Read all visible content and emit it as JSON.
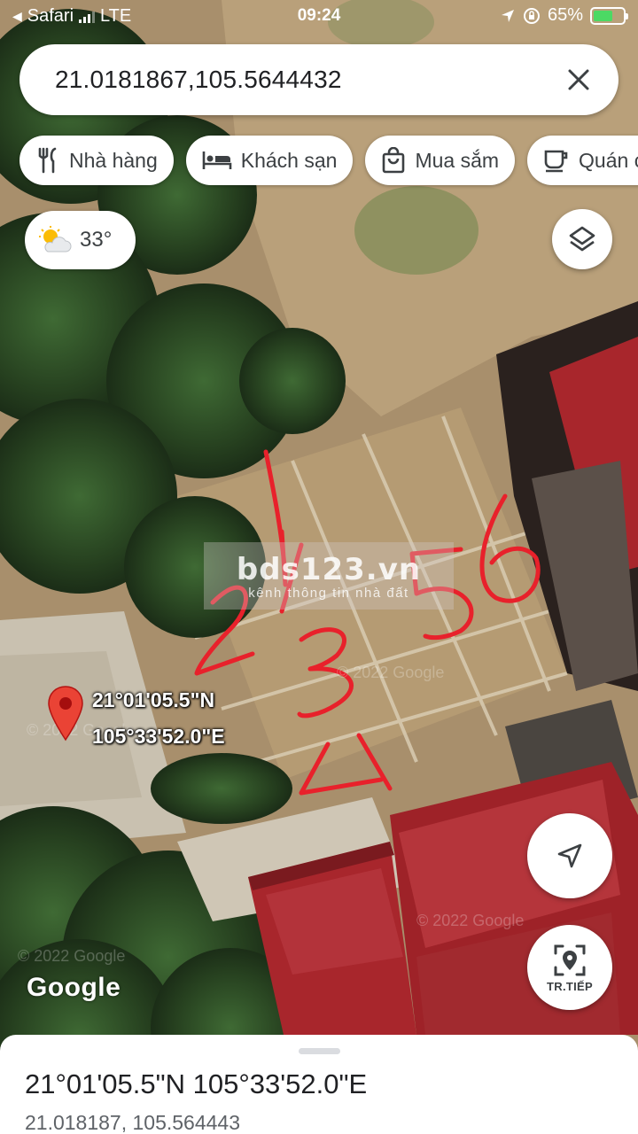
{
  "status_bar": {
    "back_app": "Safari",
    "network": "LTE",
    "time": "09:24",
    "battery_percent": "65%",
    "battery_level": 0.65
  },
  "search": {
    "value": "21.0181867,105.5644432"
  },
  "chips": [
    {
      "label": "Nhà hàng",
      "icon": "restaurant-icon"
    },
    {
      "label": "Khách sạn",
      "icon": "hotel-icon"
    },
    {
      "label": "Mua sắm",
      "icon": "shopping-bag-icon"
    },
    {
      "label": "Quán cà phê",
      "icon": "coffee-icon"
    }
  ],
  "weather": {
    "temperature": "33°",
    "icon": "partly-cloudy-icon"
  },
  "watermark": {
    "brand": "bds123.vn",
    "tagline": "kênh thông tin nhà đất"
  },
  "map": {
    "pin_lat_dms": "21°01'05.5\"N",
    "pin_lng_dms": "105°33'52.0\"E",
    "handwritten_marks": [
      "1",
      "2",
      "3",
      "4",
      "5",
      "6"
    ],
    "attribution": "Google"
  },
  "street_view": {
    "label": "TR.TIẾP"
  },
  "sheet": {
    "title": "21°01'05.5\"N 105°33'52.0\"E",
    "subtitle": "21.018187, 105.564443"
  },
  "colors": {
    "pin": "#ea4335",
    "handwriting": "#e8212b",
    "roof": "#a8262c",
    "ground": "#b39a76",
    "vegetation": "#2e4a26"
  }
}
